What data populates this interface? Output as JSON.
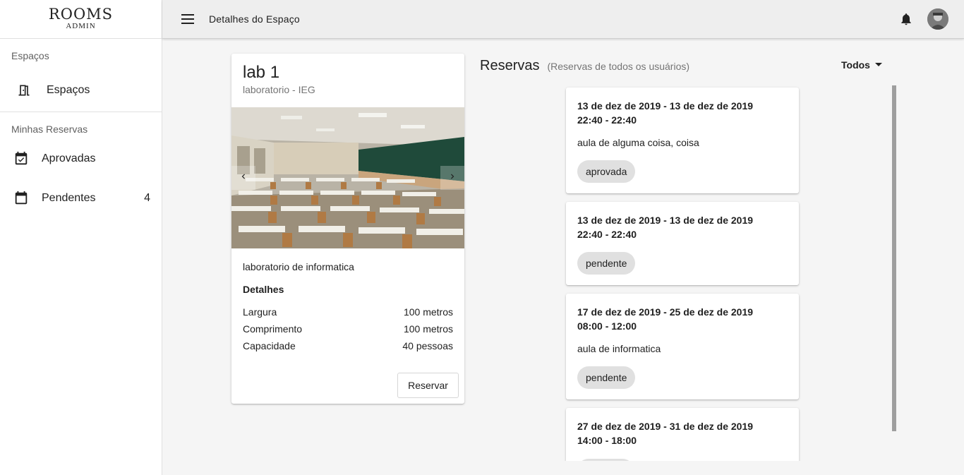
{
  "logo": {
    "main": "ROOMS",
    "sub": "ADMIN"
  },
  "sidebar": {
    "section1_title": "Espaços",
    "section2_title": "Minhas Reservas",
    "items": [
      {
        "label": "Espaços",
        "icon": "door-icon"
      },
      {
        "label": "Aprovadas",
        "icon": "calendar-check-icon"
      },
      {
        "label": "Pendentes",
        "icon": "calendar-icon",
        "count": "4"
      }
    ]
  },
  "topbar": {
    "title": "Detalhes do Espaço"
  },
  "room": {
    "name": "lab 1",
    "subtitle": "laboratorio - IEG",
    "description": "laboratorio de informatica",
    "details_title": "Detalhes",
    "details": [
      {
        "label": "Largura",
        "value": "100 metros"
      },
      {
        "label": "Comprimento",
        "value": "100 metros"
      },
      {
        "label": "Capacidade",
        "value": "40 pessoas"
      }
    ],
    "reserve_label": "Reservar"
  },
  "reservations": {
    "title": "Reservas",
    "subtitle": "(Reservas de todos os usuários)",
    "filter_label": "Todos",
    "items": [
      {
        "dates": "13 de dez de 2019 - 13 de dez de 2019",
        "times": "22:40 - 22:40",
        "description": "aula de alguma coisa, coisa",
        "status": "aprovada"
      },
      {
        "dates": "13 de dez de 2019 - 13 de dez de 2019",
        "times": "22:40 - 22:40",
        "description": "",
        "status": "pendente"
      },
      {
        "dates": "17 de dez de 2019 - 25 de dez de 2019",
        "times": "08:00 - 12:00",
        "description": "aula de informatica",
        "status": "pendente"
      },
      {
        "dates": "27 de dez de 2019 - 31 de dez de 2019",
        "times": "14:00 - 18:00",
        "description": "",
        "status": ""
      }
    ]
  },
  "colors": {
    "chip_bg": "#e0e0e0",
    "topbar_bg": "#eeeeee",
    "page_bg": "#f5f5f5"
  }
}
